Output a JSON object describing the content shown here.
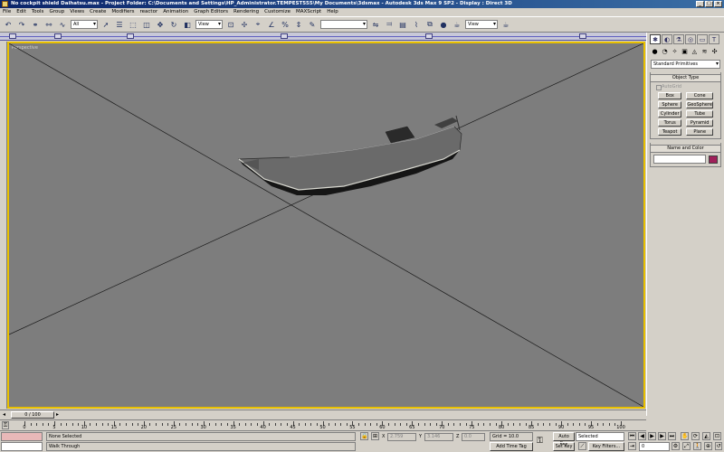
{
  "window": {
    "title": "No cockpit shield Daihatsu.max    - Project Folder: C:\\Documents and Settings\\HP_Administrator.TEMPEST555\\My Documents\\3dsmax    - Autodesk 3ds Max 9 SP2    - Display : Direct 3D",
    "controls": [
      "_",
      "□",
      "×"
    ]
  },
  "menu": [
    "File",
    "Edit",
    "Tools",
    "Group",
    "Views",
    "Create",
    "Modifiers",
    "reactor",
    "Animation",
    "Graph Editors",
    "Rendering",
    "Customize",
    "MAXScript",
    "Help"
  ],
  "toolbar": {
    "selection_filter": "All",
    "ref_coord_1": "View",
    "ref_coord_2": "View",
    "named_selection": ""
  },
  "viewport": {
    "label": "Perspective",
    "bg_color": "#7d7d7d",
    "border_color": "#e8c000",
    "object": "boat hull model"
  },
  "command_panel": {
    "tabs": [
      "create-tab",
      "modify-tab",
      "hierarchy-tab",
      "motion-tab",
      "display-tab",
      "utilities-tab"
    ],
    "category_icons": [
      "geometry-icon",
      "shapes-icon",
      "lights-icon",
      "cameras-icon",
      "helpers-icon",
      "spacewarps-icon",
      "systems-icon"
    ],
    "dropdown": "Standard Primitives",
    "object_type": {
      "header": "Object Type",
      "autogrid": "AutoGrid",
      "buttons": [
        "Box",
        "Cone",
        "Sphere",
        "GeoSphere",
        "Cylinder",
        "Tube",
        "Torus",
        "Pyramid",
        "Teapot",
        "Plane"
      ]
    },
    "name_color": {
      "header": "Name and Color",
      "name_value": "",
      "swatch_color": "#a0205a"
    }
  },
  "time_slider": {
    "label": "0 / 100",
    "current_frame": 0,
    "total_frames": 100
  },
  "trackbar": {
    "labels": [
      "0",
      "5",
      "10",
      "15",
      "20",
      "25",
      "30",
      "35",
      "40",
      "45",
      "50",
      "55",
      "60",
      "65",
      "70",
      "75",
      "80",
      "85",
      "90",
      "95",
      "100"
    ]
  },
  "status": {
    "selection": "None Selected",
    "prompt": "Walk Through",
    "x_label": "X",
    "x_value": "2.759",
    "y_label": "Y",
    "y_value": "3.146",
    "z_label": "Z",
    "z_value": "0.0",
    "grid": "Grid = 10.0",
    "add_time_tag": "Add Time Tag",
    "auto_key": "Auto Key",
    "set_key": "Set Key",
    "key_mode": "Selected",
    "key_filters": "Key Filters...",
    "frame": "0"
  }
}
